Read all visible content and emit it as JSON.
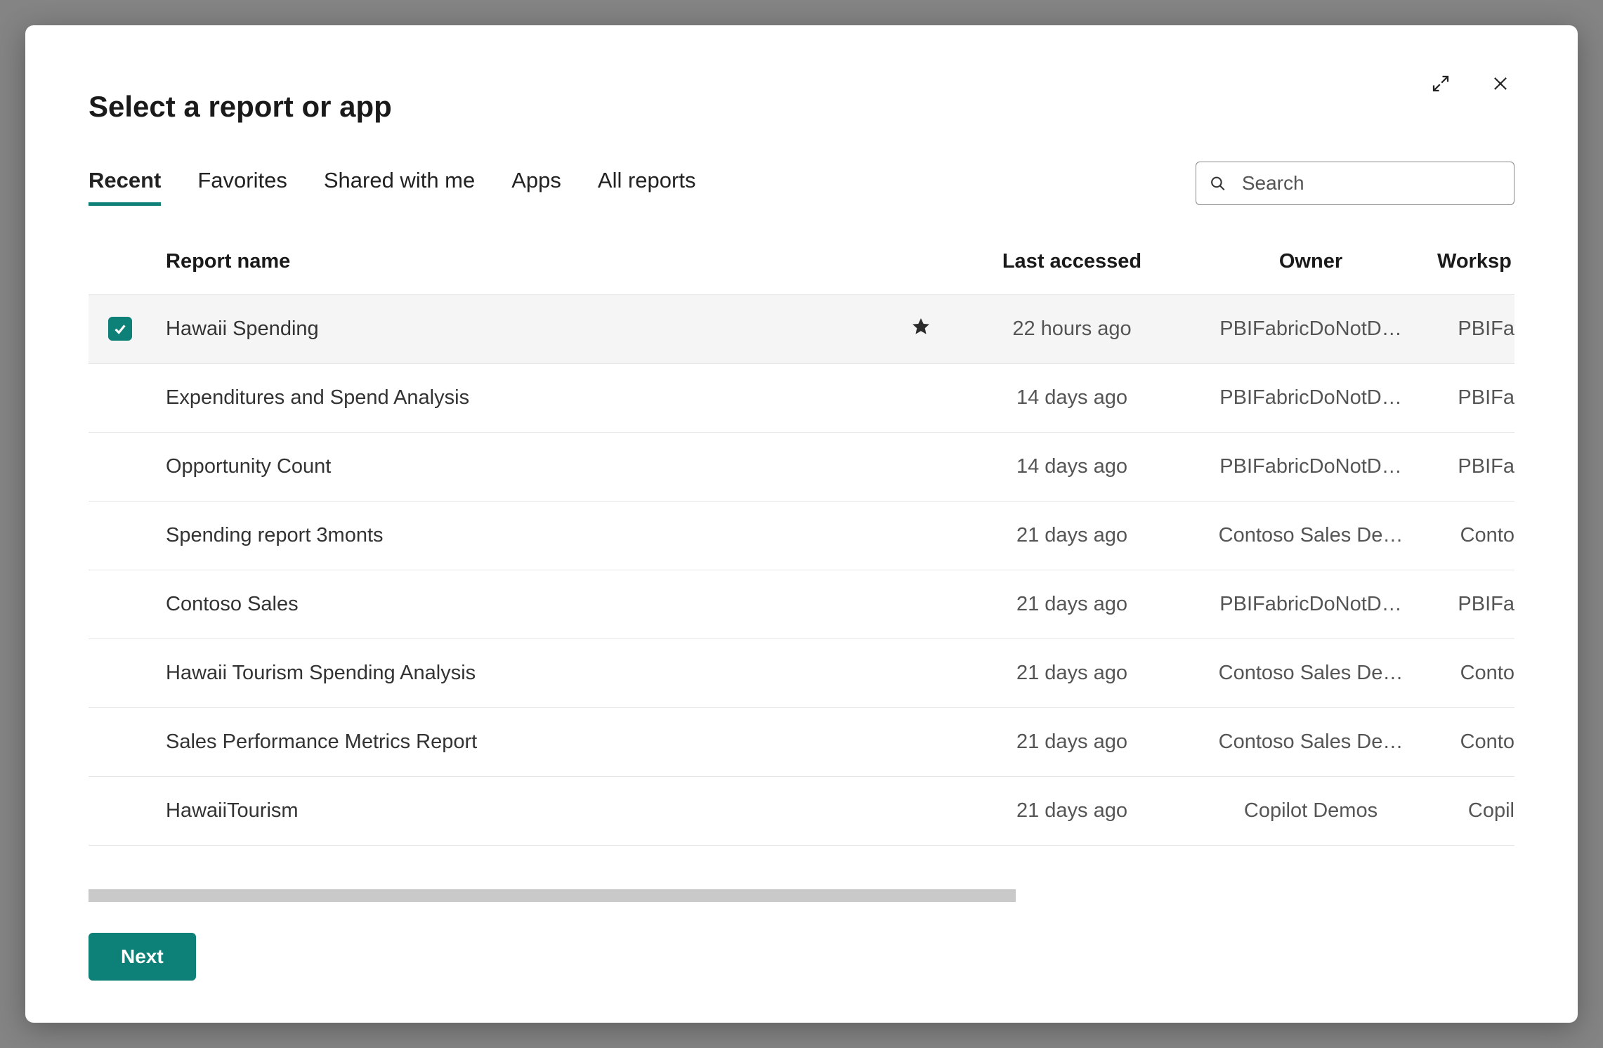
{
  "modal": {
    "title": "Select a report or app",
    "next_label": "Next"
  },
  "tabs": [
    {
      "label": "Recent",
      "active": true
    },
    {
      "label": "Favorites",
      "active": false
    },
    {
      "label": "Shared with me",
      "active": false
    },
    {
      "label": "Apps",
      "active": false
    },
    {
      "label": "All reports",
      "active": false
    }
  ],
  "search": {
    "placeholder": "Search",
    "value": ""
  },
  "columns": {
    "name": "Report name",
    "last": "Last accessed",
    "owner": "Owner",
    "workspace": "Worksp"
  },
  "rows": [
    {
      "selected": true,
      "favorite": true,
      "name": "Hawaii Spending",
      "last": "22 hours ago",
      "owner": "PBIFabricDoNotD…",
      "workspace": "PBIFa"
    },
    {
      "selected": false,
      "favorite": false,
      "name": "Expenditures and Spend Analysis",
      "last": "14 days ago",
      "owner": "PBIFabricDoNotD…",
      "workspace": "PBIFa"
    },
    {
      "selected": false,
      "favorite": false,
      "name": "Opportunity Count",
      "last": "14 days ago",
      "owner": "PBIFabricDoNotD…",
      "workspace": "PBIFa"
    },
    {
      "selected": false,
      "favorite": false,
      "name": "Spending report 3monts",
      "last": "21 days ago",
      "owner": "Contoso Sales De…",
      "workspace": "Conto"
    },
    {
      "selected": false,
      "favorite": false,
      "name": "Contoso Sales",
      "last": "21 days ago",
      "owner": "PBIFabricDoNotD…",
      "workspace": "PBIFa"
    },
    {
      "selected": false,
      "favorite": false,
      "name": "Hawaii Tourism Spending Analysis",
      "last": "21 days ago",
      "owner": "Contoso Sales De…",
      "workspace": "Conto"
    },
    {
      "selected": false,
      "favorite": false,
      "name": "Sales Performance Metrics Report",
      "last": "21 days ago",
      "owner": "Contoso Sales De…",
      "workspace": "Conto"
    },
    {
      "selected": false,
      "favorite": false,
      "name": "HawaiiTourism",
      "last": "21 days ago",
      "owner": "Copilot Demos",
      "workspace": "Copil"
    }
  ]
}
